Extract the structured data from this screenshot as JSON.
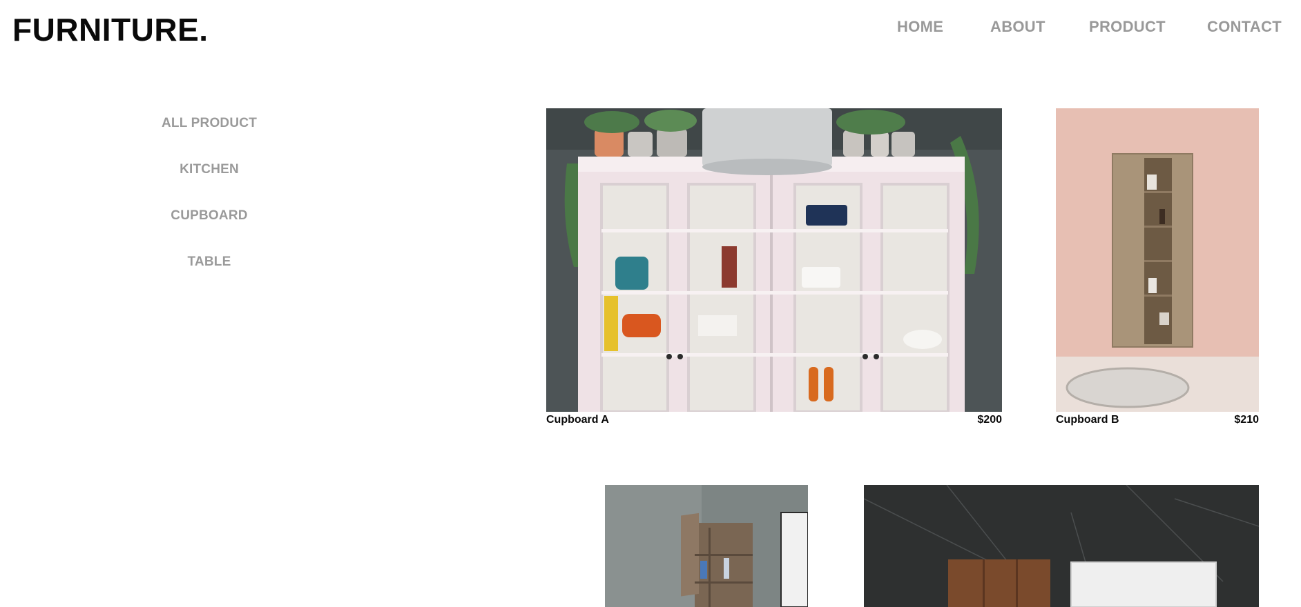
{
  "brand": {
    "logo": "FURNITURE."
  },
  "nav": {
    "home": "HOME",
    "about": "ABOUT",
    "product": "PRODUCT",
    "contact": "CONTACT"
  },
  "categories": [
    "ALL PRODUCT",
    "KITCHEN",
    "CUPBOARD",
    "TABLE"
  ],
  "products": [
    {
      "name": "Cupboard A",
      "price": "$200"
    },
    {
      "name": "Cupboard B",
      "price": "$210"
    }
  ],
  "colors": {
    "text": "#0a0a0a",
    "muted": "#999999",
    "background": "#ffffff"
  }
}
